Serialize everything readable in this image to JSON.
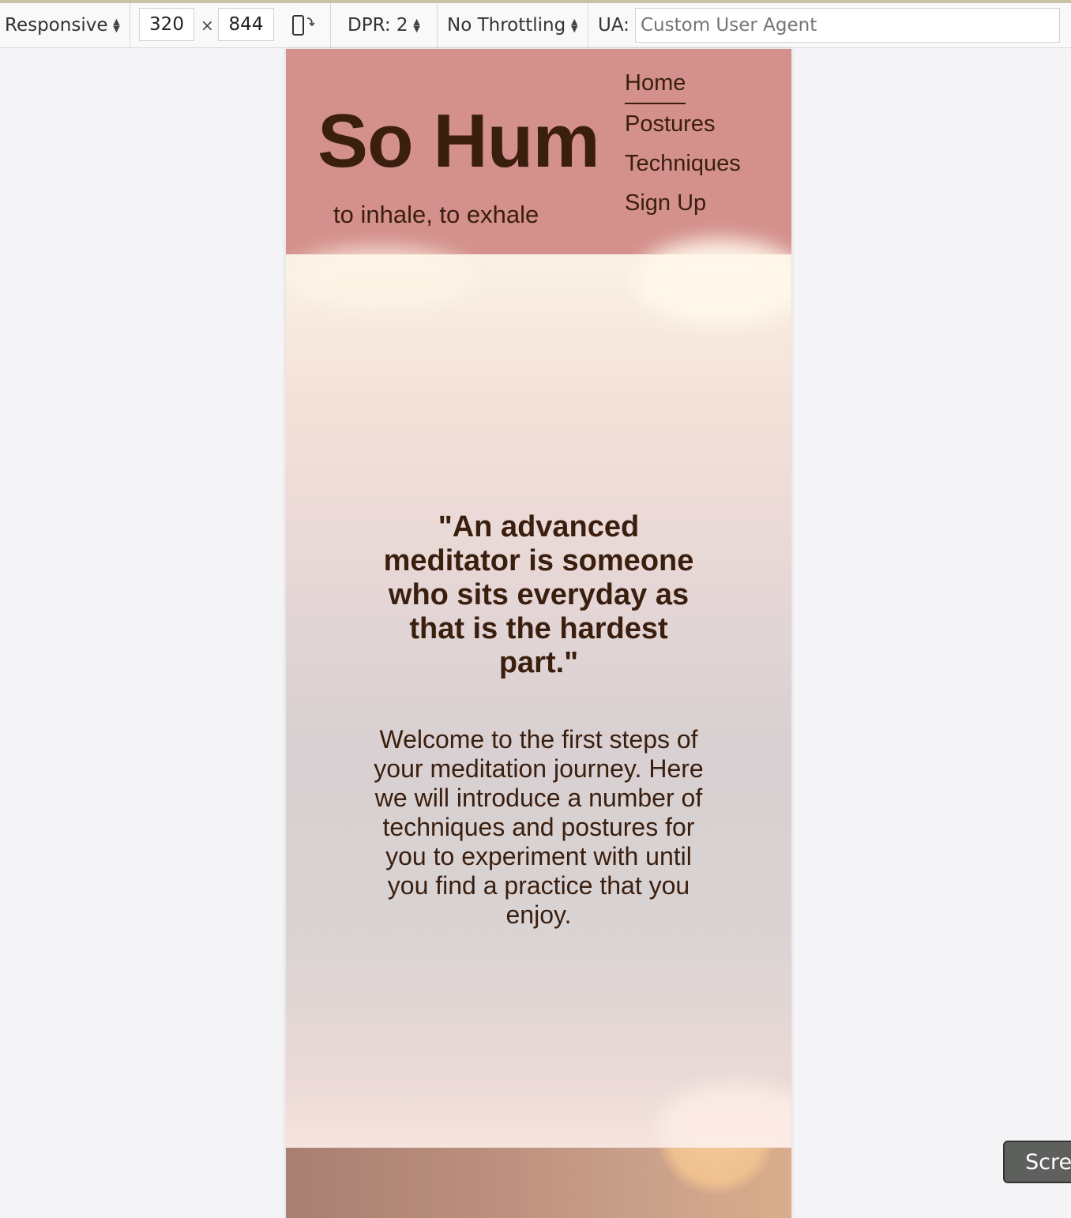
{
  "toolbar": {
    "device_preset": "Responsive",
    "width": "320",
    "separator": "×",
    "height": "844",
    "dpr": "DPR: 2",
    "throttling": "No Throttling",
    "ua_label": "UA:",
    "ua_placeholder": "Custom User Agent"
  },
  "site": {
    "logo": "So Hum",
    "tagline": "to inhale, to exhale",
    "nav": [
      "Home",
      "Postures",
      "Techniques",
      "Sign Up"
    ],
    "active_nav": "Home"
  },
  "hero": {
    "quote": "\"An advanced meditator is someone who sits everyday as that is the hardest part.\"",
    "welcome": "Welcome to the first steps of your meditation journey. Here we will introduce a number of techniques and postures for you to experiment with until you find a practice that you enjoy."
  },
  "overlay": {
    "screenshot_button": "Screenshot"
  },
  "colors": {
    "header_bg": "#d4908c",
    "text_brown": "#3a1e0e"
  }
}
